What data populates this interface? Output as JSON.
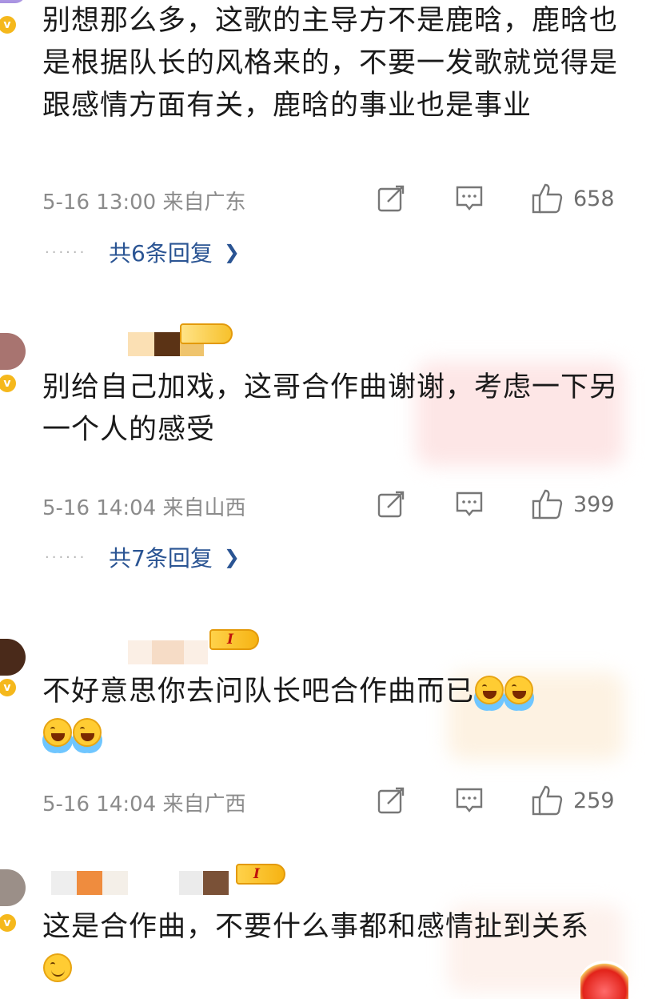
{
  "comments": [
    {
      "text": "别想那么多，这歌的主导方不是鹿晗，鹿晗也是根据队长的风格来的，不要一发歌就觉得是跟感情方面有关，鹿晗的事业也是事业",
      "time": "5-16 13:00",
      "location": "来自广东",
      "likes": "658",
      "replies_label": "共6条回复"
    },
    {
      "text": "别给自己加戏，这哥合作曲谢谢，考虑一下另一个人的感受",
      "time": "5-16 14:04",
      "location": "来自山西",
      "likes": "399",
      "replies_label": "共7条回复"
    },
    {
      "text": "不好意思你去问队长吧合作曲而已",
      "time": "5-16 14:04",
      "location": "来自广西",
      "likes": "259",
      "level_badge": "I"
    },
    {
      "text": "这是合作曲，不要什么事都和感情扯到关系",
      "level_badge": "I"
    }
  ],
  "icons": {
    "verified": "verified-v-icon",
    "share": "share-icon",
    "comment": "comment-icon",
    "like": "thumbs-up-icon",
    "chevron": "chevron-right-icon",
    "laugh_cry": "laughing-tears-emoji",
    "smile": "smile-emoji"
  },
  "colors": {
    "text": "#1a1a1a",
    "meta": "#8b8b8b",
    "reply_link": "#2a5493",
    "badge_gold": "#f6b313"
  }
}
